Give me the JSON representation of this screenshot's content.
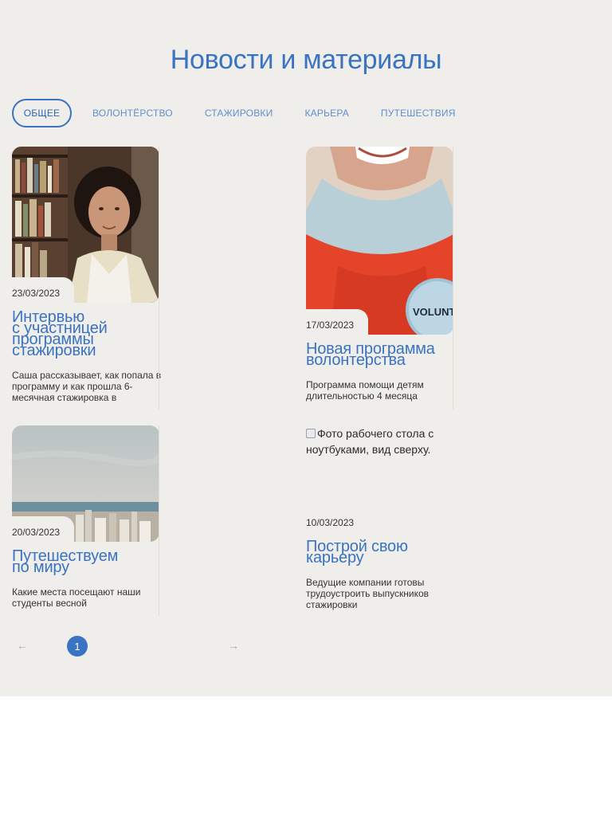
{
  "section": {
    "title": "Новости и материалы"
  },
  "tabs": [
    {
      "label": "ОБЩЕЕ",
      "active": true
    },
    {
      "label": "ВОЛОНТЁРСТВО",
      "active": false
    },
    {
      "label": "СТАЖИРОВКИ",
      "active": false
    },
    {
      "label": "КАРЬЕРА",
      "active": false
    },
    {
      "label": "ПУТЕШЕСТВИЯ",
      "active": false
    }
  ],
  "cards": [
    {
      "date": "23/03/2023",
      "title_lines": [
        "Интервью",
        "с участницей",
        "программы",
        "стажировки"
      ],
      "description": "Саша рассказывает, как попала в программу и как прошла 6-месячная стажировка в ISOFoundation"
    },
    {
      "date": "17/03/2023",
      "title_lines": [
        "Новая программа",
        "волонтерства"
      ],
      "description": "Программа помощи детям длительностью 4 месяца",
      "badge_text": "VOLUNT"
    },
    {
      "date": "20/03/2023",
      "title_lines": [
        "Путешествуем",
        "по миру"
      ],
      "description": "Какие места посещают наши студенты весной"
    },
    {
      "date": "10/03/2023",
      "title_lines": [
        "Построй свою",
        "карьеру"
      ],
      "description": "Ведущие компании готовы трудоустроить выпускников стажировки",
      "image_alt": "Фото рабочего стола с ноутбуками, вид сверху."
    }
  ],
  "pagination": {
    "prev_icon": "arrow-left-icon",
    "next_icon": "arrow-right-icon",
    "current_page": "1"
  },
  "colors": {
    "accent": "#3a73c2",
    "section_bg": "#efeeea"
  }
}
